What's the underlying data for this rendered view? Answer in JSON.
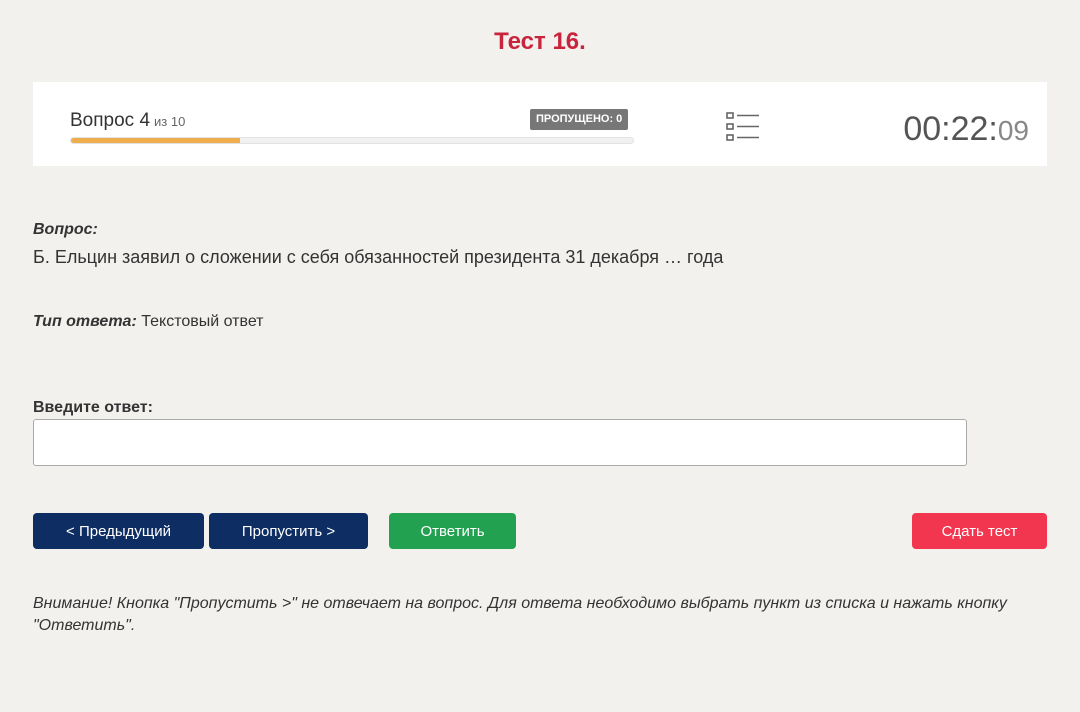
{
  "page": {
    "title": "Тест 16."
  },
  "status": {
    "question_label": "Вопрос 4",
    "question_of": "из 10",
    "progress_fraction": 0.3,
    "skipped_badge": "ПРОПУЩЕНО: 0",
    "list_icon": "question-list-icon",
    "timer_main": "00:22:",
    "timer_seconds": "09"
  },
  "question": {
    "label": "Вопрос:",
    "text": "Б. Ельцин заявил о сложении с себя обязанностей президента 31 декабря … года",
    "type_label": "Тип ответа:",
    "type_value": "Текстовый ответ"
  },
  "answer": {
    "label": "Введите ответ:",
    "value": ""
  },
  "buttons": {
    "prev": "< Предыдущий",
    "skip": "Пропустить >",
    "answer": "Ответить",
    "submit": "Сдать тест"
  },
  "note": "Внимание! Кнопка \"Пропустить >\" не отвечает на вопрос. Для ответа необходимо выбрать пункт из списка и нажать кнопку \"Ответить\".",
  "colors": {
    "title": "#c8243c",
    "progress": "#f0ad4e",
    "nav_button": "#0d2d63",
    "answer_button": "#22a151",
    "submit_button": "#f2364f"
  }
}
